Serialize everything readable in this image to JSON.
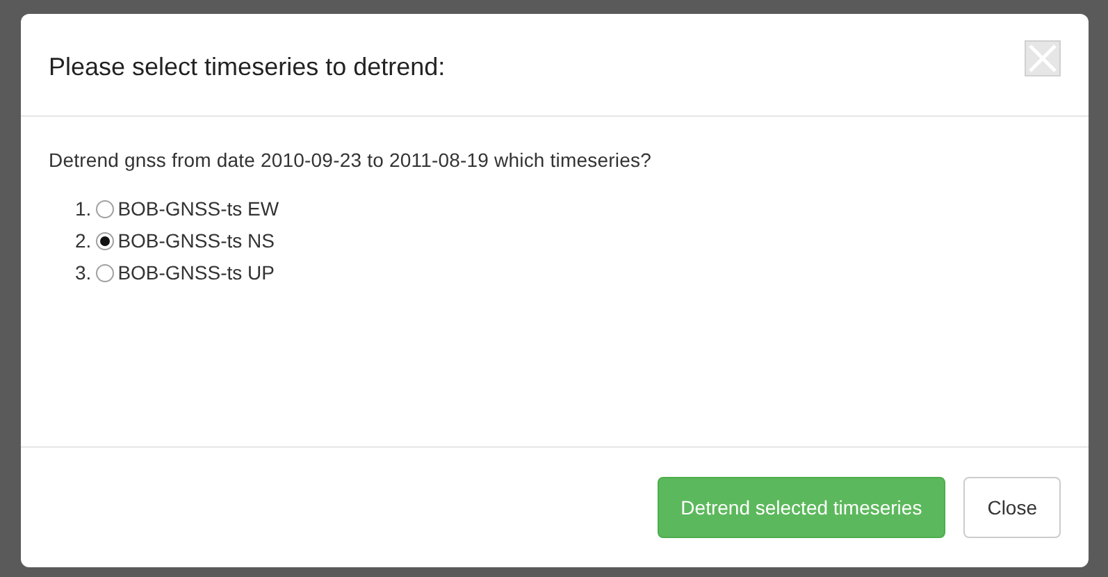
{
  "dialog": {
    "title": "Please select timeseries to detrend:",
    "message": "Detrend gnss from date 2010-09-23 to 2011-08-19 which timeseries?",
    "options": [
      {
        "number": "1.",
        "label": "BOB-GNSS-ts EW",
        "selected": false
      },
      {
        "number": "2.",
        "label": "BOB-GNSS-ts NS",
        "selected": true
      },
      {
        "number": "3.",
        "label": "BOB-GNSS-ts UP",
        "selected": false
      }
    ],
    "buttons": [
      {
        "label": "Detrend selected timeseries",
        "kind": "primary"
      },
      {
        "label": "Close",
        "kind": "default"
      }
    ]
  }
}
